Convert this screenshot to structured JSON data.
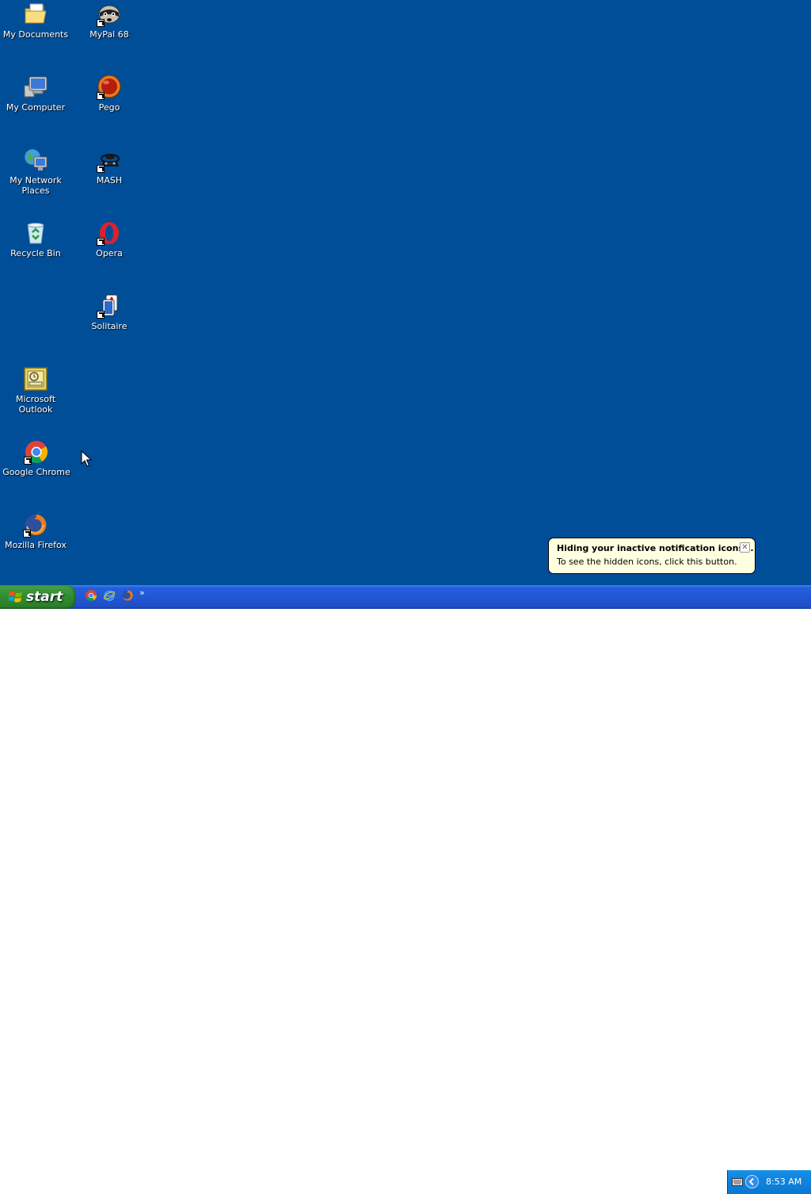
{
  "desktop": {
    "background_color": "#004e98",
    "icons": [
      {
        "label": "My Documents",
        "icon": "folder-documents-icon"
      },
      {
        "label": "MyPal 68",
        "icon": "mypal-raccoon-icon"
      },
      {
        "label": "My Computer",
        "icon": "computer-icon"
      },
      {
        "label": "Pego",
        "icon": "pego-ball-icon"
      },
      {
        "label": "My Network Places",
        "icon": "network-globe-icon"
      },
      {
        "label": "MASH",
        "icon": "mash-icon"
      },
      {
        "label": "Recycle Bin",
        "icon": "recycle-bin-icon"
      },
      {
        "label": "Opera",
        "icon": "opera-icon"
      },
      {
        "label": "Solitaire",
        "icon": "solitaire-cards-icon"
      },
      {
        "label": "Microsoft Outlook",
        "icon": "outlook-icon"
      },
      {
        "label": "Google Chrome",
        "icon": "chrome-icon"
      },
      {
        "label": "Mozilla Firefox",
        "icon": "firefox-icon"
      }
    ]
  },
  "balloon": {
    "title": "Hiding your inactive notification icons...",
    "text": "To see the hidden icons, click this button.",
    "close_icon": "close-icon"
  },
  "taskbar": {
    "start_label": "start",
    "quick_launch": [
      {
        "icon": "chrome-icon"
      },
      {
        "icon": "internet-explorer-icon"
      },
      {
        "icon": "firefox-icon"
      }
    ],
    "overflow_chevron": "»",
    "clock": "8:53 AM",
    "colors": {
      "taskbar_blue": "#245edb",
      "start_green": "#3c983c",
      "tray_blue": "#0f85df"
    }
  }
}
